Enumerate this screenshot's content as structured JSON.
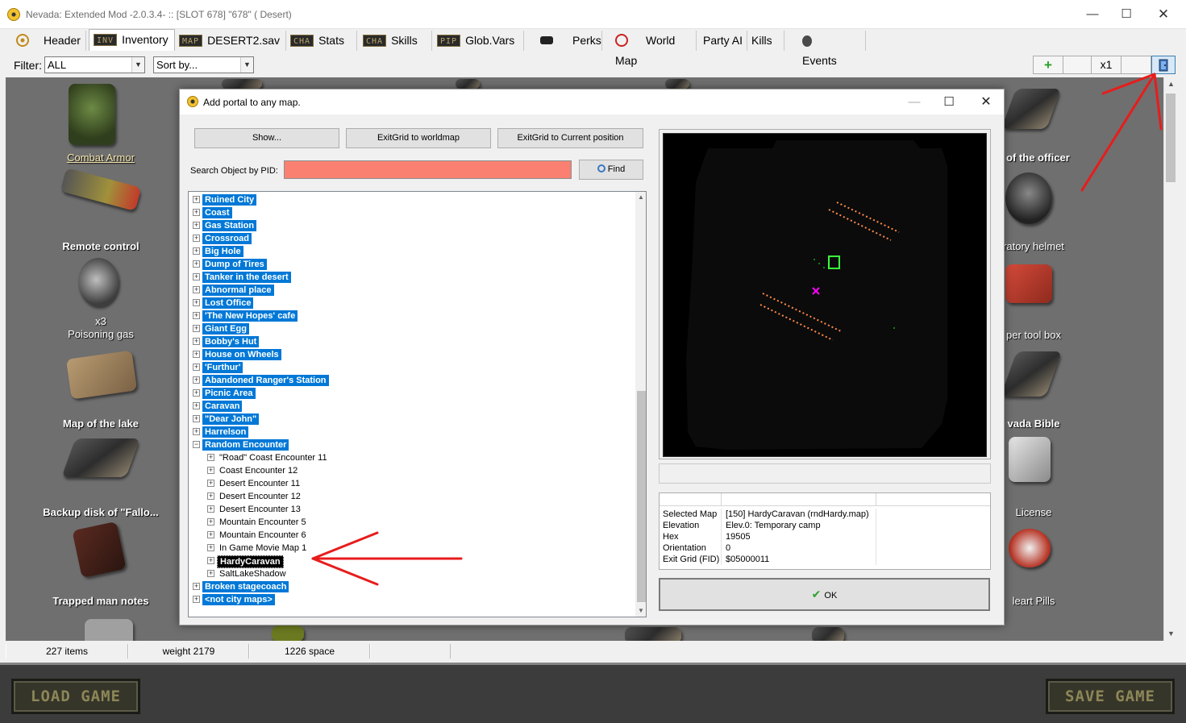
{
  "window": {
    "title": "Nevada: Extended Mod -2.0.3.4- :: [SLOT 678] \"678\" ( Desert)",
    "minimize": "—",
    "maximize": "☐",
    "close": "✕"
  },
  "menu": {
    "header": "Header",
    "inventory_tag": "INV",
    "inventory": "Inventory",
    "map_tag": "MAP",
    "map": "DESERT2.sav",
    "stats_tag": "CHA",
    "stats": "Stats",
    "skills_tag": "CHA",
    "skills": "Skills",
    "globvars_tag": "PIP",
    "globvars": "Glob.Vars",
    "perks": "Perks",
    "worldmap": "World Map",
    "partyai": "Party AI",
    "kills": "Kills",
    "events": "Events"
  },
  "filterbar": {
    "filter_label": "Filter:",
    "filter_value": "ALL",
    "sort_value": "Sort by...",
    "add_icon": "+",
    "multiplier": "x1"
  },
  "inventory": {
    "left_items": [
      {
        "label": "Combat Armor"
      },
      {
        "label": "Remote control"
      },
      {
        "label": "x3\nPoisoning gas"
      },
      {
        "label": "Map of the lake"
      },
      {
        "label": "Backup disk of \"Fallo..."
      },
      {
        "label": "Trapped man notes"
      }
    ],
    "right_items": [
      {
        "label": "s of the officer"
      },
      {
        "label": "ratory helmet"
      },
      {
        "label": "per tool box"
      },
      {
        "label": "vada Bible"
      },
      {
        "label": "License"
      },
      {
        "label": "leart Pills"
      }
    ]
  },
  "statusbar": {
    "items": "227 items",
    "weight": "weight 2179",
    "space": "1226 space"
  },
  "bottom": {
    "load": "LOAD GAME",
    "save": "SAVE GAME"
  },
  "dialog": {
    "title": "Add portal to any map.",
    "minimize": "—",
    "maximize": "☐",
    "close": "✕",
    "show_btn": "Show...",
    "exit_world_btn": "ExitGrid to worldmap",
    "exit_current_btn": "ExitGrid to Current position",
    "pid_label": "Search Object by PID:",
    "pid_value": "",
    "find_btn": "Find",
    "tree": [
      {
        "label": "Ruined City",
        "level": 0,
        "expander": "+",
        "style": "sel"
      },
      {
        "label": "Coast",
        "level": 0,
        "expander": "+",
        "style": "sel"
      },
      {
        "label": "Gas Station",
        "level": 0,
        "expander": "+",
        "style": "sel"
      },
      {
        "label": "Crossroad",
        "level": 0,
        "expander": "+",
        "style": "sel"
      },
      {
        "label": "Big Hole",
        "level": 0,
        "expander": "+",
        "style": "sel"
      },
      {
        "label": "Dump of Tires",
        "level": 0,
        "expander": "+",
        "style": "sel"
      },
      {
        "label": "Tanker in the desert",
        "level": 0,
        "expander": "+",
        "style": "sel"
      },
      {
        "label": "Abnormal place",
        "level": 0,
        "expander": "+",
        "style": "sel"
      },
      {
        "label": "Lost Office",
        "level": 0,
        "expander": "+",
        "style": "sel"
      },
      {
        "label": "'The New Hopes' cafe",
        "level": 0,
        "expander": "+",
        "style": "sel"
      },
      {
        "label": "Giant Egg",
        "level": 0,
        "expander": "+",
        "style": "sel"
      },
      {
        "label": "Bobby's Hut",
        "level": 0,
        "expander": "+",
        "style": "sel"
      },
      {
        "label": "House on Wheels",
        "level": 0,
        "expander": "+",
        "style": "sel"
      },
      {
        "label": "'Furthur'",
        "level": 0,
        "expander": "+",
        "style": "sel"
      },
      {
        "label": "Abandoned Ranger's Station",
        "level": 0,
        "expander": "+",
        "style": "sel"
      },
      {
        "label": "Picnic Area",
        "level": 0,
        "expander": "+",
        "style": "sel"
      },
      {
        "label": "Caravan",
        "level": 0,
        "expander": "+",
        "style": "sel"
      },
      {
        "label": "\"Dear John\"",
        "level": 0,
        "expander": "+",
        "style": "sel"
      },
      {
        "label": "Harrelson",
        "level": 0,
        "expander": "+",
        "style": "sel"
      },
      {
        "label": "Random Encounter",
        "level": 0,
        "expander": "−",
        "style": "sel"
      },
      {
        "label": "\"Road\" Coast Encounter  11",
        "level": 1,
        "expander": "+",
        "style": "child"
      },
      {
        "label": "Coast Encounter  12",
        "level": 1,
        "expander": "+",
        "style": "child"
      },
      {
        "label": "Desert Encounter  11",
        "level": 1,
        "expander": "+",
        "style": "child"
      },
      {
        "label": "Desert Encounter  12",
        "level": 1,
        "expander": "+",
        "style": "child"
      },
      {
        "label": "Desert Encounter  13",
        "level": 1,
        "expander": "+",
        "style": "child"
      },
      {
        "label": "Mountain Encounter  5",
        "level": 1,
        "expander": "+",
        "style": "child"
      },
      {
        "label": "Mountain Encounter  6",
        "level": 1,
        "expander": "+",
        "style": "child"
      },
      {
        "label": "In Game Movie Map  1",
        "level": 1,
        "expander": "+",
        "style": "child"
      },
      {
        "label": "HardyCaravan",
        "level": 1,
        "expander": "+",
        "style": "focus"
      },
      {
        "label": "SaltLakeShadow",
        "level": 1,
        "expander": "+",
        "style": "child"
      },
      {
        "label": "Broken stagecoach",
        "level": 0,
        "expander": "+",
        "style": "sel"
      },
      {
        "label": "<not city maps>",
        "level": 0,
        "expander": "+",
        "style": "sel"
      }
    ],
    "info": [
      {
        "key": "Selected Map",
        "value": "[150] HardyCaravan (rndHardy.map)"
      },
      {
        "key": "Elevation",
        "value": "Elev.0: Temporary camp"
      },
      {
        "key": "Hex",
        "value": "19505"
      },
      {
        "key": "Orientation",
        "value": "0"
      },
      {
        "key": "Exit Grid (FID)",
        "value": "$05000011"
      }
    ],
    "ok": "OK"
  },
  "colors": {
    "selection": "#0078d7",
    "pid_input": "#fa8072",
    "annotation_arrow": "#e81c1c",
    "preview_orange": "#ff8c4a",
    "preview_green": "#39ff39",
    "preview_magenta": "#ff00ff"
  }
}
